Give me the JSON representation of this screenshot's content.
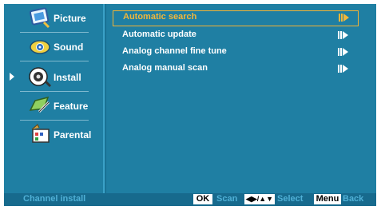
{
  "sidebar": {
    "items": [
      {
        "label": "Picture",
        "icon": "picture-icon"
      },
      {
        "label": "Sound",
        "icon": "sound-icon"
      },
      {
        "label": "Install",
        "icon": "install-icon",
        "selected": true
      },
      {
        "label": "Feature",
        "icon": "feature-icon"
      },
      {
        "label": "Parental",
        "icon": "parental-icon"
      }
    ]
  },
  "menu": {
    "items": [
      {
        "label": "Automatic search",
        "active": true
      },
      {
        "label": "Automatic update"
      },
      {
        "label": "Analog channel fine tune"
      },
      {
        "label": "Analog manual scan"
      }
    ]
  },
  "footer": {
    "title": "Channel install",
    "ok_key": "OK",
    "scan_label": "Scan",
    "nav_key": "◀▶/▲▼",
    "select_label": "Select",
    "menu_key": "Menu",
    "back_label": "Back"
  },
  "colors": {
    "background": "#1f7fa3",
    "footer_bg": "#176a8d",
    "highlight": "#f2b73a",
    "footer_text": "#4fb0d6"
  }
}
